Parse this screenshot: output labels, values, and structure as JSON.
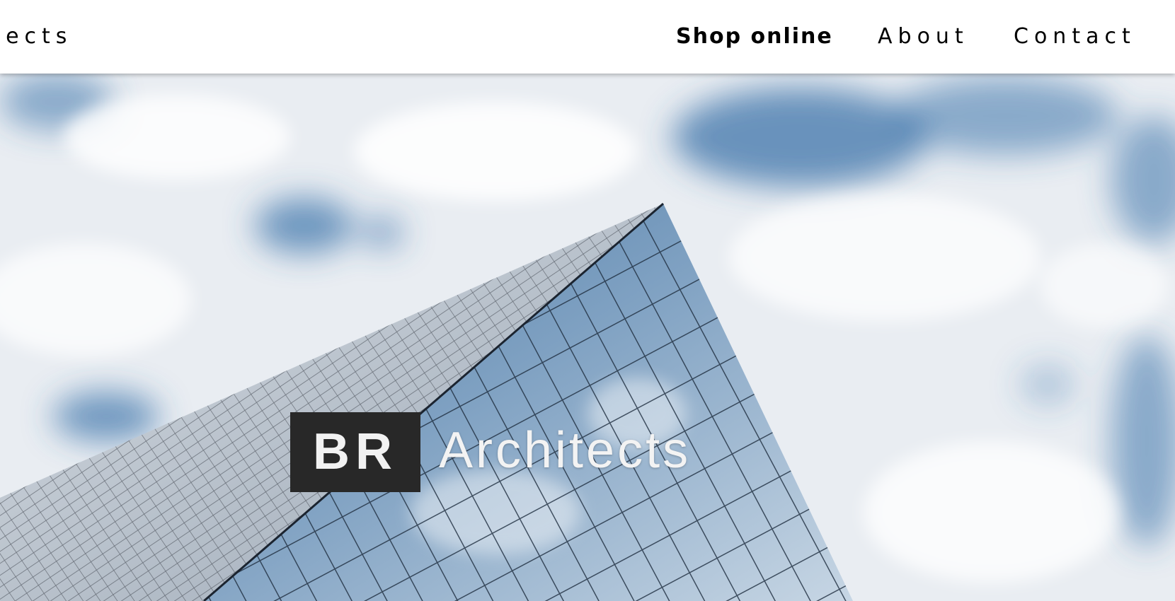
{
  "header": {
    "brand": "itects",
    "nav": {
      "shop": "Shop online",
      "about": "About",
      "contact": "Contact"
    }
  },
  "hero": {
    "logo_box": "BR",
    "logo_text": "Architects",
    "image": "glass skyscraper against cloudy blue sky"
  },
  "colors": {
    "logo_box_bg": "#282828",
    "sky_blue": "#3d73aa",
    "cloud_white": "#f2f4f7"
  }
}
